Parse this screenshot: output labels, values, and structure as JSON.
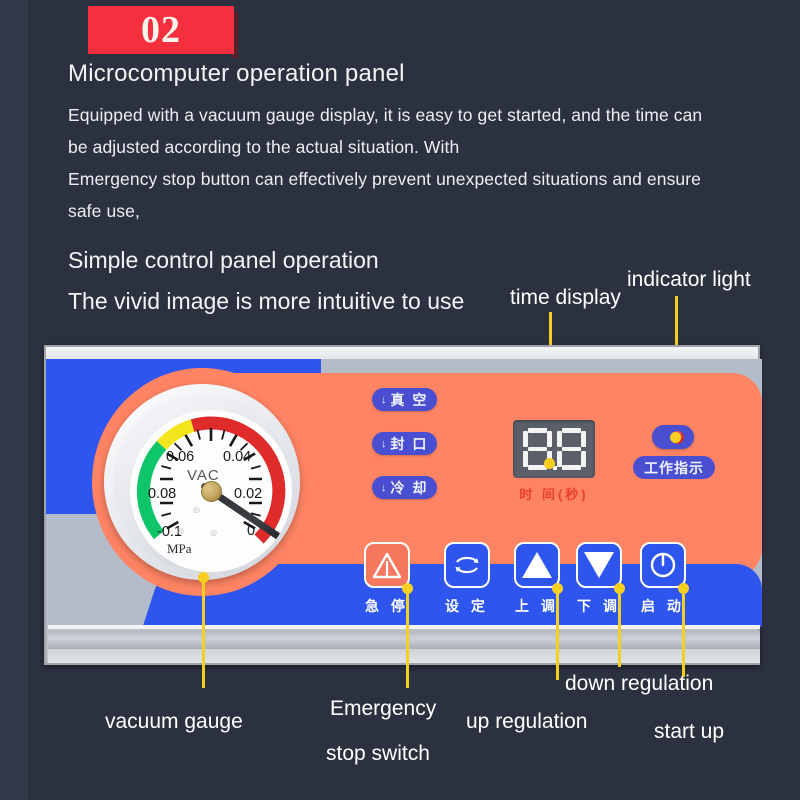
{
  "header": {
    "badge_number": "02",
    "title": "Microcomputer operation panel",
    "body_lines": [
      "Equipped with a vacuum gauge display, it is easy to get started, and the time can",
      "be adjusted according to the actual situation. With",
      "Emergency stop button can effectively prevent unexpected situations and ensure",
      "safe use,"
    ],
    "subtitle_1": "Simple control panel operation",
    "subtitle_2": "The vivid image is more intuitive to use"
  },
  "callouts": {
    "top": [
      {
        "id": "time-display",
        "label": "time display"
      },
      {
        "id": "indicator-light",
        "label": "indicator light"
      }
    ],
    "bottom": [
      {
        "id": "vacuum-gauge",
        "label": "vacuum gauge"
      },
      {
        "id": "emergency-stop-1",
        "label": "Emergency"
      },
      {
        "id": "emergency-stop-2",
        "label": "stop switch"
      },
      {
        "id": "up-regulation",
        "label": "up regulation"
      },
      {
        "id": "down-regulation",
        "label": "down regulation"
      },
      {
        "id": "start-up",
        "label": "start up"
      }
    ]
  },
  "panel": {
    "gauge": {
      "brand": "VAC",
      "unit": "MPa",
      "tick_labels": [
        "-0.1",
        "0.08",
        "0.06",
        "0.04",
        "0.02",
        "0"
      ],
      "needle_value": "-0.02"
    },
    "status_pills": [
      {
        "id": "vacuum",
        "label": "真 空",
        "arrow": "↓"
      },
      {
        "id": "sealing",
        "label": "封 口",
        "arrow": "↓"
      },
      {
        "id": "cooling",
        "label": "冷 却",
        "arrow": "↓"
      }
    ],
    "time_display": {
      "value": "8.8",
      "digits": [
        "8",
        "8"
      ],
      "label": "时 间(秒)"
    },
    "indicator": {
      "label": "工作指示",
      "led_color": "#d9332c"
    },
    "buttons": [
      {
        "id": "emergency-stop",
        "label": "急 停",
        "icon": "warning-triangle-icon",
        "style": "estop"
      },
      {
        "id": "set",
        "label": "设 定",
        "icon": "cycle-arrows-icon",
        "style": "blue"
      },
      {
        "id": "up",
        "label": "上 调",
        "icon": "triangle-up-icon",
        "style": "blue"
      },
      {
        "id": "down",
        "label": "下 调",
        "icon": "triangle-down-icon",
        "style": "blue"
      },
      {
        "id": "start",
        "label": "启 动",
        "icon": "power-icon",
        "style": "blue"
      }
    ]
  },
  "colors": {
    "background": "#2c313f",
    "badge": "#f5303e",
    "panel_orange": "#ff8464",
    "panel_blue": "#2f55ef",
    "callout_yellow": "#f5d020",
    "lcd_digit": "#f4f4f2",
    "lcd_label_red": "#e8402a"
  }
}
